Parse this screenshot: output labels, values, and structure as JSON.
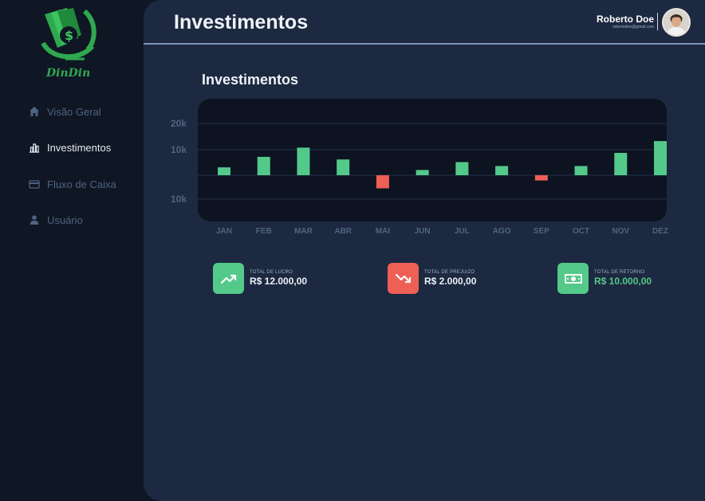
{
  "brand": {
    "name": "DinDin"
  },
  "sidebar": {
    "items": [
      {
        "label": "Visão Geral",
        "icon": "home-icon",
        "active": false
      },
      {
        "label": "Investimentos",
        "icon": "bar-chart-icon",
        "active": true
      },
      {
        "label": "Fluxo de Caixa",
        "icon": "credit-card-icon",
        "active": false
      },
      {
        "label": "Usuário",
        "icon": "user-icon",
        "active": false
      }
    ]
  },
  "header": {
    "title": "Investimentos",
    "user": {
      "name": "Roberto Doe",
      "email": "robertodoe@gmail.com"
    }
  },
  "section": {
    "title": "Investimentos"
  },
  "colors": {
    "positive": "#53c98a",
    "negative": "#ee5f55",
    "brand": "#2fa84f"
  },
  "chart_data": {
    "type": "bar",
    "title": "",
    "xlabel": "",
    "ylabel": "",
    "y_tick_labels": [
      "20k",
      "10k",
      "10k"
    ],
    "categories": [
      "JAN",
      "FEB",
      "MAR",
      "ABR",
      "MAI",
      "JUN",
      "JUL",
      "AGO",
      "SEP",
      "OCT",
      "NOV",
      "DEZ"
    ],
    "values": [
      3000,
      7000,
      10500,
      6000,
      -5000,
      2000,
      5000,
      3500,
      -2000,
      3500,
      8500,
      13000
    ],
    "ylim": [
      -9000,
      20000
    ],
    "grid": true
  },
  "stats": [
    {
      "label": "TOTAL DE LUCRO",
      "value": "R$ 12.000,00",
      "icon": "trending-up-icon"
    },
    {
      "label": "TOTAL DE PREJUIZO",
      "value": "R$ 2.000,00",
      "icon": "trending-down-icon"
    },
    {
      "label": "TOTAL DE RETORNO",
      "value": "R$ 10.000,00",
      "icon": "cash-icon"
    }
  ]
}
